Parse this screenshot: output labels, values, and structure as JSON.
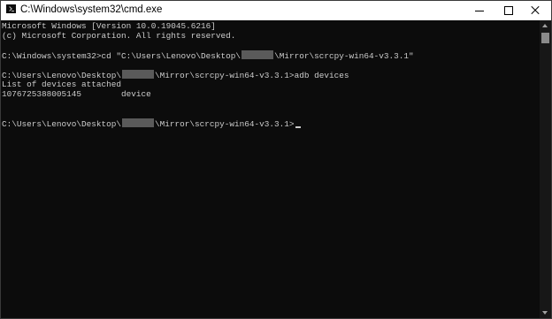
{
  "window": {
    "title": "C:\\Windows\\system32\\cmd.exe",
    "icon": "cmd-icon"
  },
  "console": {
    "line1": "Microsoft Windows [Version 10.0.19045.6216]",
    "line2": "(c) Microsoft Corporation. All rights reserved.",
    "cmd1_prompt": "C:\\Windows\\system32>",
    "cmd1_text_a": "cd \"C:\\Users\\Lenovo\\Desktop\\",
    "cmd1_text_b": "\\Mirror\\scrcpy-win64-v3.3.1\"",
    "prompt_a": "C:\\Users\\Lenovo\\Desktop\\",
    "prompt_b": "\\Mirror\\scrcpy-win64-v3.3.1>",
    "cmd2_text": "adb devices",
    "output1": "List of devices attached",
    "device_line": "1076725388005145        device"
  }
}
